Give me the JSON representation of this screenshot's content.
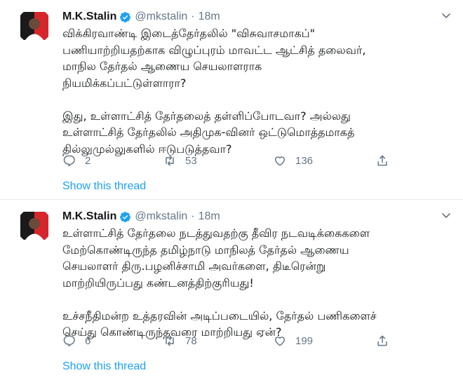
{
  "tweets": [
    {
      "author_name": "M.K.Stalin",
      "handle": "@mkstalin",
      "dot": "·",
      "time": "18m",
      "text": "விக்கிரவாண்டி இடைத்தேர்தலில் \"விசுவாசமாகப்\"\nபணியாற்றியதற்காக விழுப்புரம் மாவட்ட ஆட்சித் தலைவர்,\nமாநில தேர்தல் ஆணைய செயலாளராக\nநியமிக்கப்பட்டுள்ளாரா?\n\nஇது, உள்ளாட்சித் தேர்தலைத் தள்ளிப்போடவா? அல்லது\nஉள்ளாட்சித் தேர்தலில் அதிமுக-வினர் ஒட்டுமொத்தமாகத்\nதில்லுமுல்லுகளில் ஈடுபடுத்தவா?",
      "replies": "2",
      "retweets": "53",
      "likes": "136",
      "show_thread": "Show this thread"
    },
    {
      "author_name": "M.K.Stalin",
      "handle": "@mkstalin",
      "dot": "·",
      "time": "18m",
      "text": "உள்ளாட்சித் தேர்தலை நடத்துவதற்கு தீவிர நடவடிக்கைகளை\nமேற்கொண்டிருந்த தமிழ்நாடு மாநிலத் தேர்தல் ஆணைய\nசெயலாளர் திரு.பழனிச்சாமி அவர்களை, திடீரென்று\nமாற்றியிருப்பது கண்டனத்திற்குரியது!\n\nஉச்சநீதிமன்ற உத்தரவின் அடிப்படையில், தேர்தல் பணிகளைச்\nசெய்து கொண்டிருந்தவரை மாற்றியது ஏன்?",
      "replies": "6",
      "retweets": "78",
      "likes": "199",
      "show_thread": "Show this thread"
    }
  ],
  "icons": {
    "verified": "verified-badge-icon",
    "reply": "reply-icon",
    "retweet": "retweet-icon",
    "like": "heart-icon",
    "share": "share-icon",
    "caret": "chevron-down-icon"
  },
  "colors": {
    "link": "#1da1f2",
    "meta": "#657786",
    "avatar_red": "#d7262b",
    "avatar_dark": "#1a1a1a"
  }
}
